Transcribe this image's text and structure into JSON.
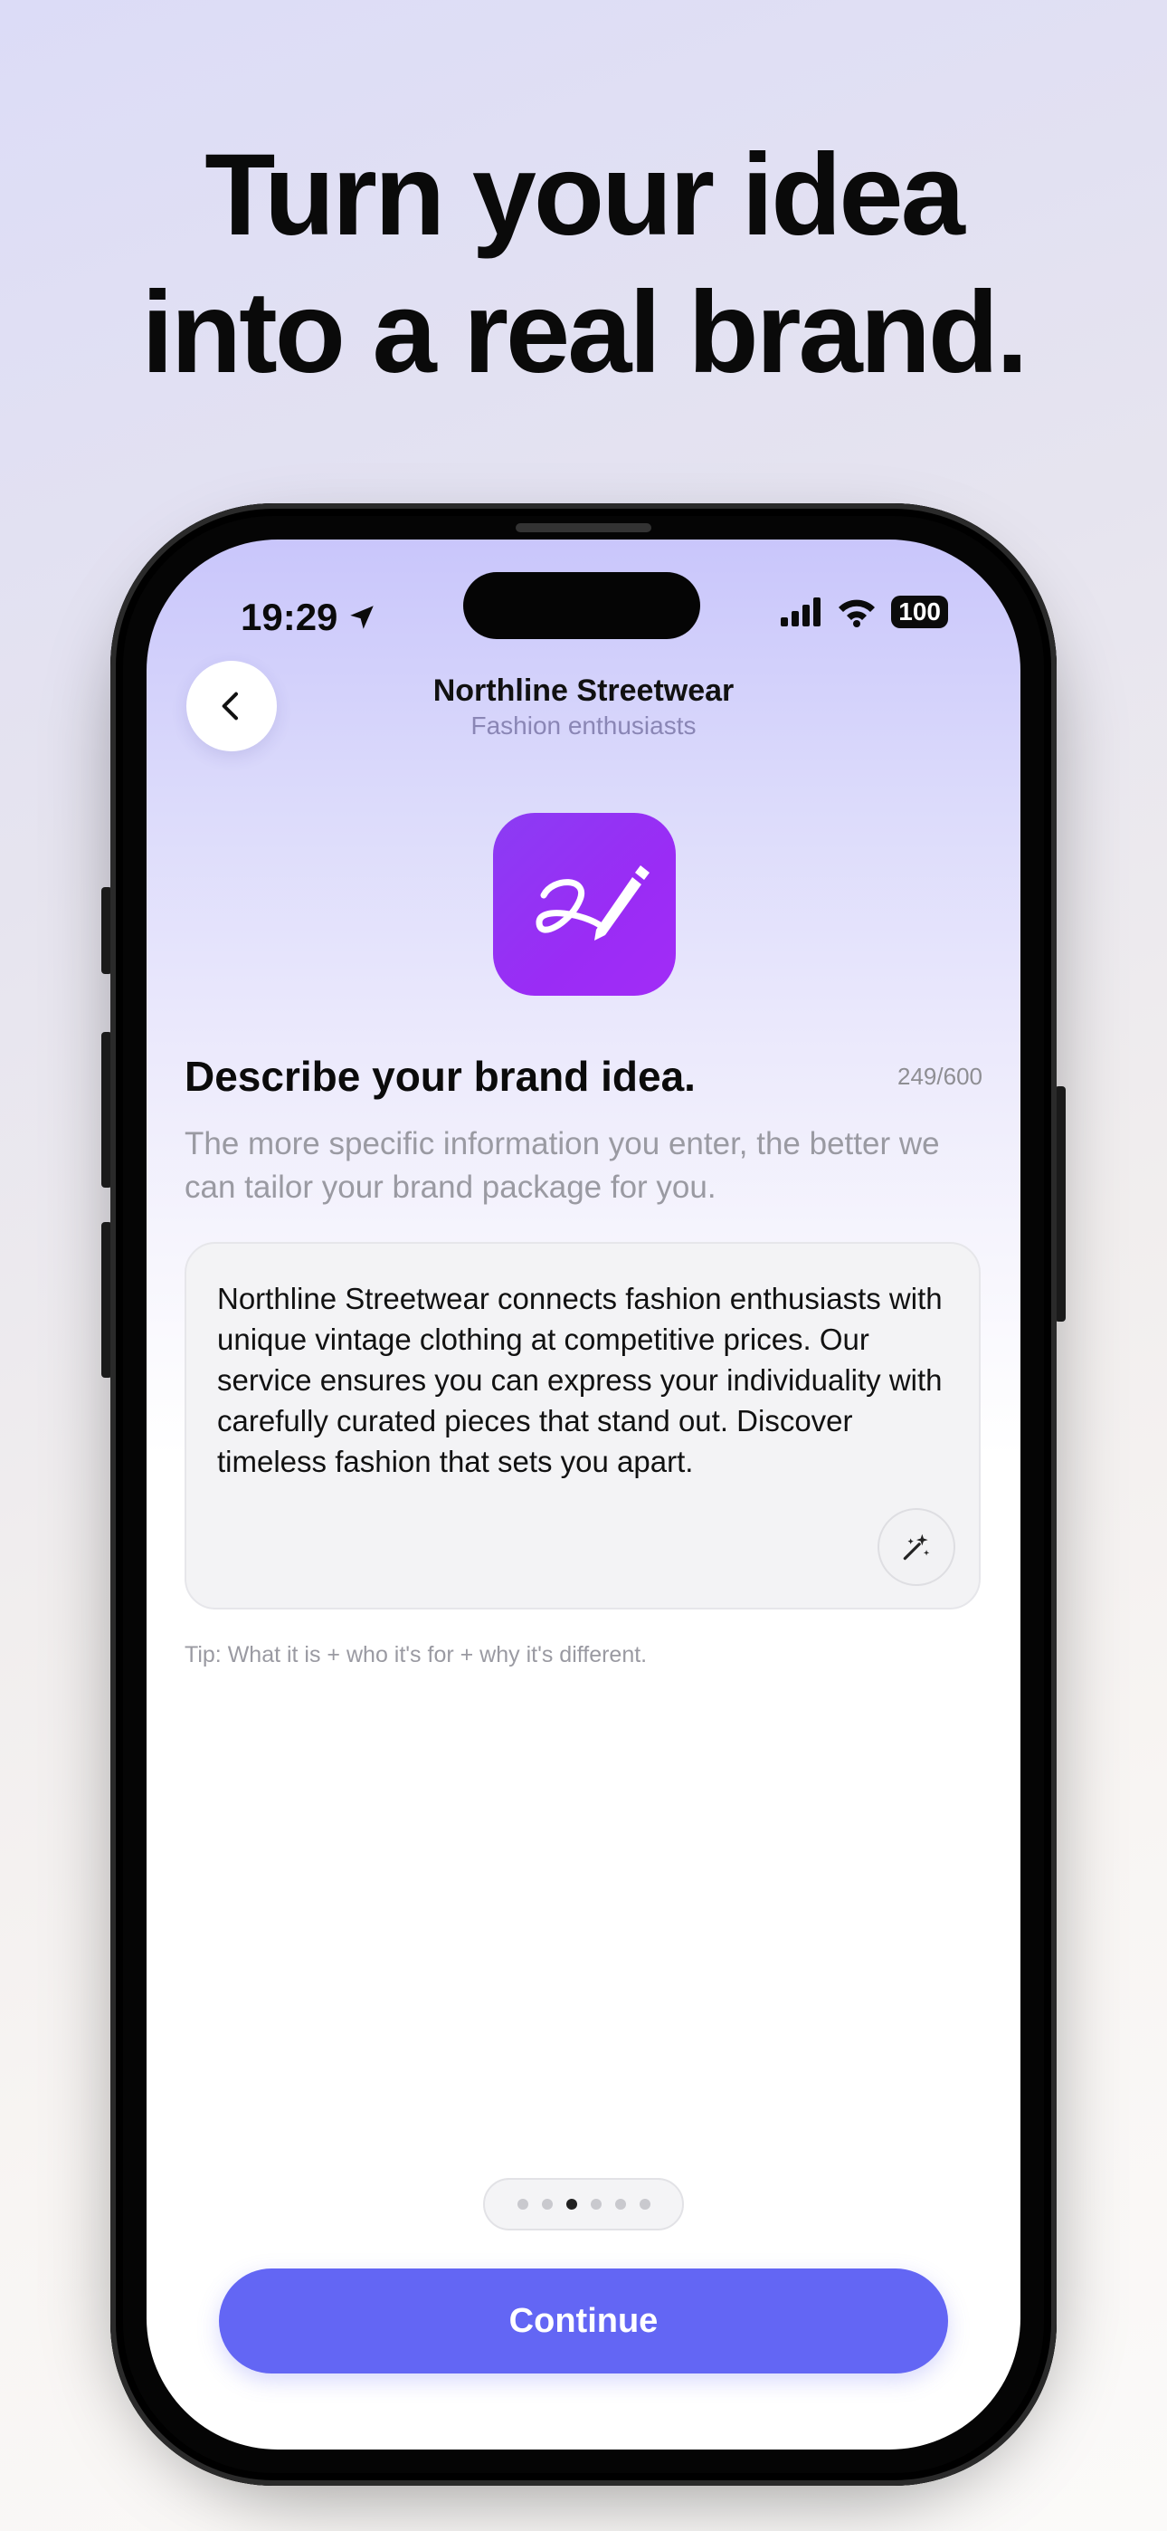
{
  "headline": {
    "line1": "Turn your idea",
    "line2": "into a real brand."
  },
  "status_bar": {
    "time": "19:29",
    "battery": "100",
    "icons": [
      "location-arrow-icon",
      "signal-icon",
      "wifi-icon",
      "battery-icon"
    ]
  },
  "header": {
    "title": "Northline Streetwear",
    "subtitle": "Fashion enthusiasts",
    "back_icon": "chevron-left-icon"
  },
  "app_icon": {
    "name": "signature-pencil-icon",
    "color": "#9a2cf5"
  },
  "form": {
    "heading": "Describe your brand idea.",
    "counter": "249/600",
    "description": "The more specific information you enter, the better we can tailor your brand package for you.",
    "text_value": "Northline Streetwear connects fashion enthusiasts with unique vintage clothing at competitive prices. Our service ensures you can express your individuality with carefully curated pieces that stand out. Discover timeless fashion that sets you apart.",
    "magic_icon": "magic-wand-icon",
    "tip": "Tip: What it is + who it's for + why it's different."
  },
  "pagination": {
    "total": 6,
    "current": 3
  },
  "continue_button": {
    "label": "Continue",
    "color": "#6366f4"
  }
}
